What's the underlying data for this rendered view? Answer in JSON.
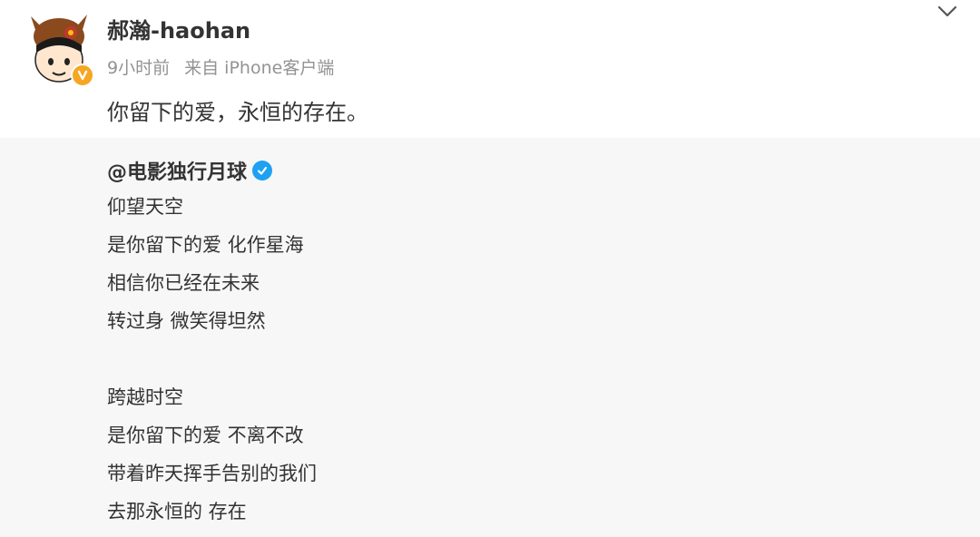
{
  "post": {
    "author_name": "郝瀚-haohan",
    "time": "9小时前",
    "source": "来自 iPhone客户端",
    "text": "你留下的爱，永恒的存在。"
  },
  "repost": {
    "original_author": "@电影独行月球",
    "stanzas": [
      [
        "仰望天空",
        "是你留下的爱 化作星海",
        "相信你已经在未来",
        "转过身 微笑得坦然"
      ],
      [
        "跨越时空",
        "是你留下的爱 不离不改",
        "带着昨天挥手告别的我们",
        "去那永恒的 存在"
      ]
    ]
  },
  "colors": {
    "text_primary": "#333333",
    "text_meta": "#939393",
    "repost_background": "#f7f7f7",
    "verified_personal": "#f5a623",
    "verified_org": "#1da1f2"
  },
  "icons": {
    "avatar": "cartoon-avatar",
    "personal_verified": "gold-v-badge",
    "org_verified": "blue-check-badge",
    "menu": "chevron-down"
  }
}
